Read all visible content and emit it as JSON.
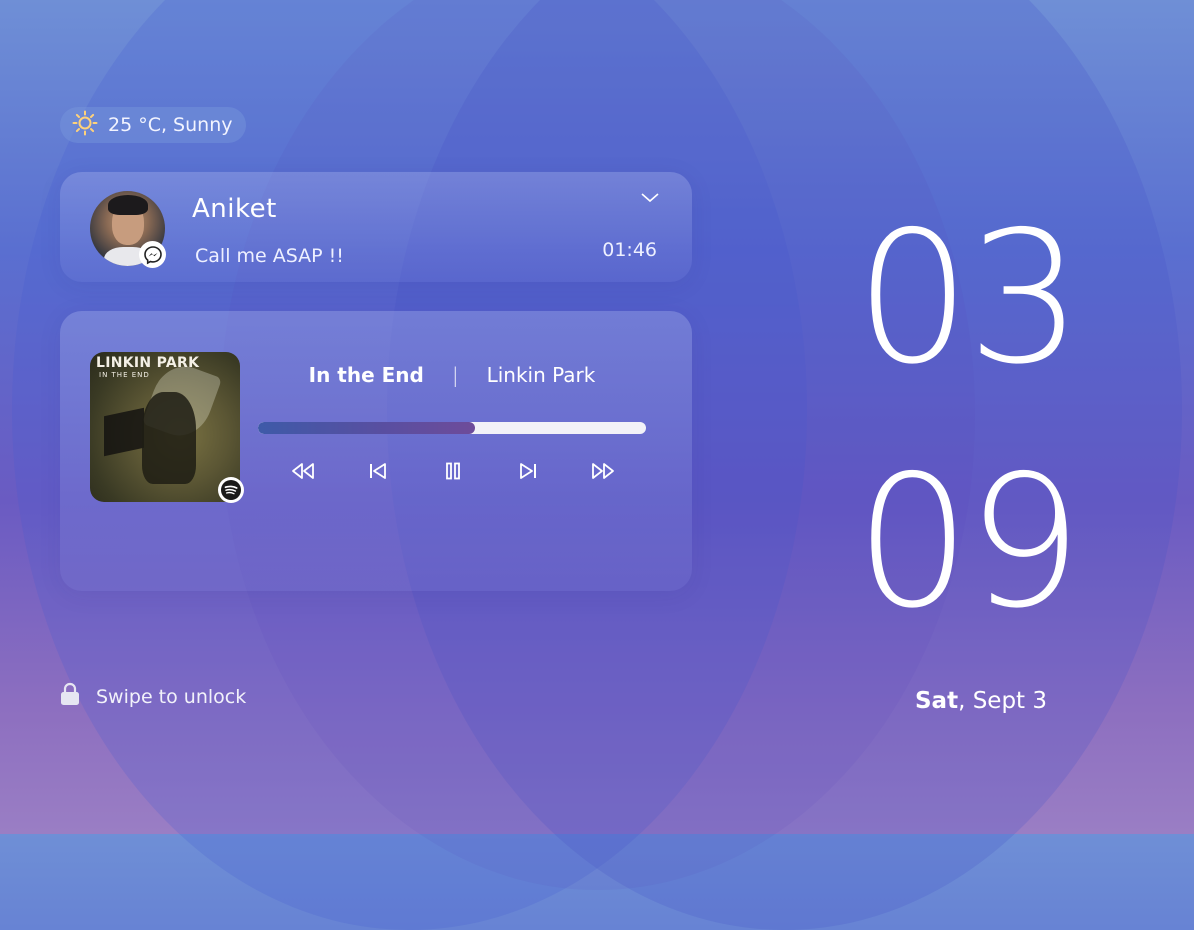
{
  "weather": {
    "icon": "sun-icon",
    "text": "25 °C, Sunny"
  },
  "notification": {
    "sender": "Aniket",
    "message": "Call me ASAP !!",
    "time": "01:46",
    "app_icon": "messenger-icon"
  },
  "music": {
    "album_band": "LINKIN PARK",
    "album_subtitle": "IN THE END",
    "title": "In the End",
    "separator": "|",
    "artist": "Linkin Park",
    "progress": 0.56,
    "app_icon": "spotify-icon",
    "controls": [
      "rewind-icon",
      "previous-icon",
      "pause-icon",
      "next-icon",
      "fast-forward-icon"
    ]
  },
  "lock": {
    "text": "Swipe to unlock",
    "icon": "lock-icon"
  },
  "clock": {
    "hours": "03",
    "minutes": "09"
  },
  "date": {
    "day": "Sat",
    "rest": ", Sept 3"
  },
  "colors": {
    "progress_fill": "#4e56a4",
    "progress_track": "#f2f2f8"
  }
}
